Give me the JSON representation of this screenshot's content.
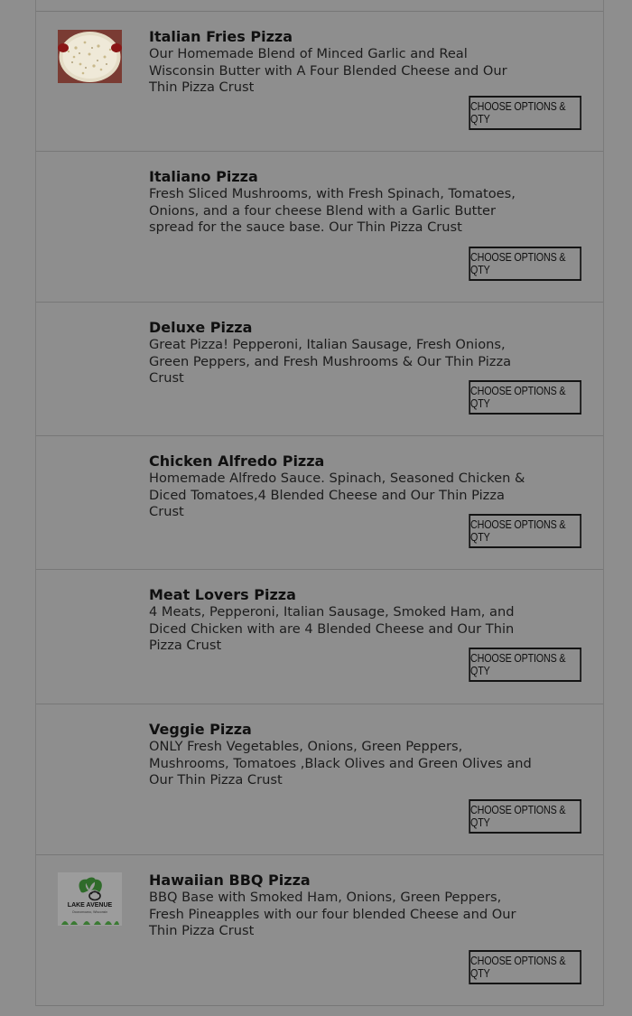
{
  "button_label": "CHOOSE OPTIONS & QTY",
  "items": [
    {
      "name": "Italian Fries Pizza",
      "description": "Our Homemade Blend of Minced Garlic and Real Wisconsin Butter with A Four Blended Cheese and Our Thin Pizza Crust",
      "image": "pizza-photo"
    },
    {
      "name": "Italiano Pizza",
      "description": "Fresh Sliced Mushrooms, with Fresh Spinach, Tomatoes, Onions, and a four cheese Blend with a Garlic Butter spread for the sauce base. Our Thin Pizza Crust"
    },
    {
      "name": "Deluxe Pizza",
      "description": "Great Pizza! Pepperoni, Italian Sausage, Fresh Onions, Green Peppers, and Fresh Mushrooms & Our Thin Pizza Crust"
    },
    {
      "name": "Chicken Alfredo Pizza",
      "description": "Homemade Alfredo Sauce. Spinach, Seasoned Chicken & Diced Tomatoes,4 Blended Cheese and Our Thin Pizza Crust"
    },
    {
      "name": "Meat Lovers Pizza",
      "description": "4 Meats, Pepperoni, Italian Sausage, Smoked Ham, and Diced Chicken with are 4 Blended Cheese and Our Thin Pizza Crust"
    },
    {
      "name": "Veggie Pizza",
      "description": "ONLY Fresh Vegetables, Onions, Green Peppers, Mushrooms, Tomatoes ,Black Olives and Green Olives and Our Thin Pizza Crust"
    },
    {
      "name": "Hawaiian BBQ Pizza",
      "description": "BBQ Base with Smoked Ham, Onions, Green Peppers, Fresh Pineapples with our four blended Cheese and Our Thin Pizza Crust",
      "image": "lake-avenue-logo",
      "logo_text": "LAKE AVENUE",
      "logo_subtext": "Oconomowoc, Wisconsin"
    }
  ]
}
